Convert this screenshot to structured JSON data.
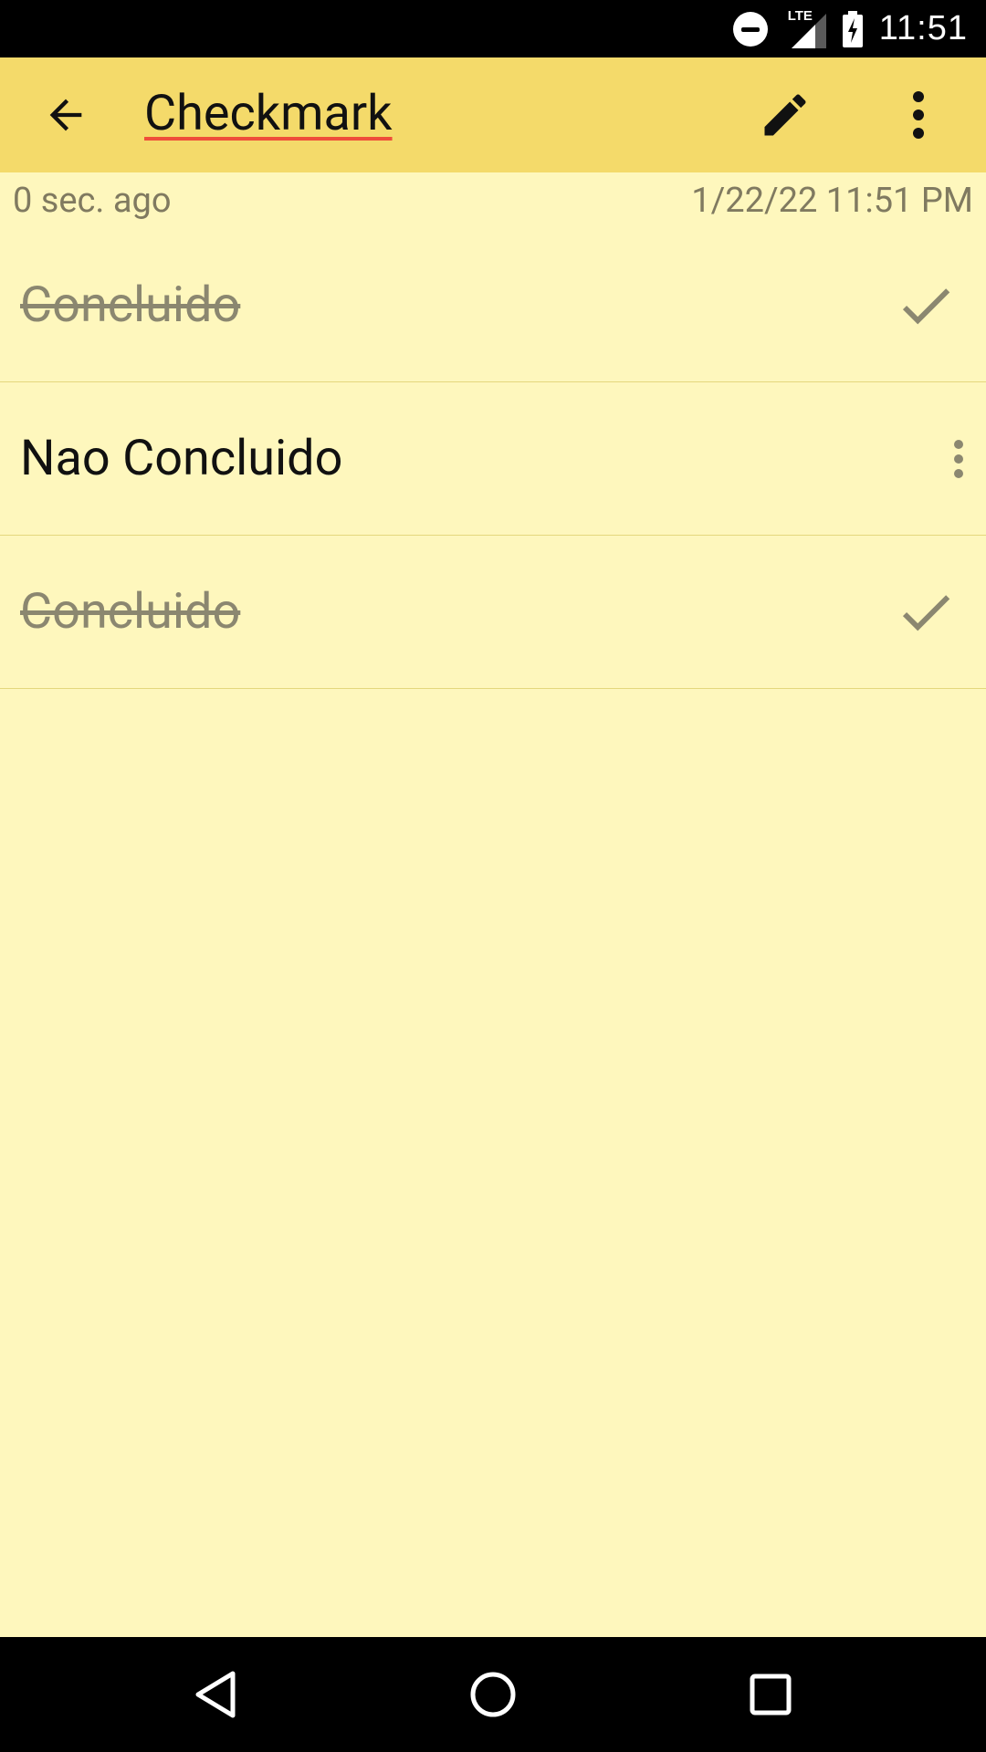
{
  "status_bar": {
    "network": "LTE",
    "time": "11:51",
    "icons": [
      "do-not-disturb-icon",
      "lte-signal-icon",
      "battery-charging-icon"
    ]
  },
  "app_bar": {
    "title": "Checkmark",
    "actions": [
      "back-arrow-icon",
      "edit-pencil-icon",
      "more-vert-icon"
    ],
    "background": "#f4da6a"
  },
  "note": {
    "relative_time": "0 sec. ago",
    "timestamp": "1/22/22 11:51 PM",
    "background": "#fef7bd"
  },
  "checklist": {
    "items": [
      {
        "label": "Concluido",
        "checked": true
      },
      {
        "label": "Nao Concluido",
        "checked": false
      },
      {
        "label": "Concluido",
        "checked": true
      }
    ]
  },
  "nav_bar": {
    "buttons": [
      "back-triangle-icon",
      "home-circle-icon",
      "recents-square-icon"
    ]
  }
}
